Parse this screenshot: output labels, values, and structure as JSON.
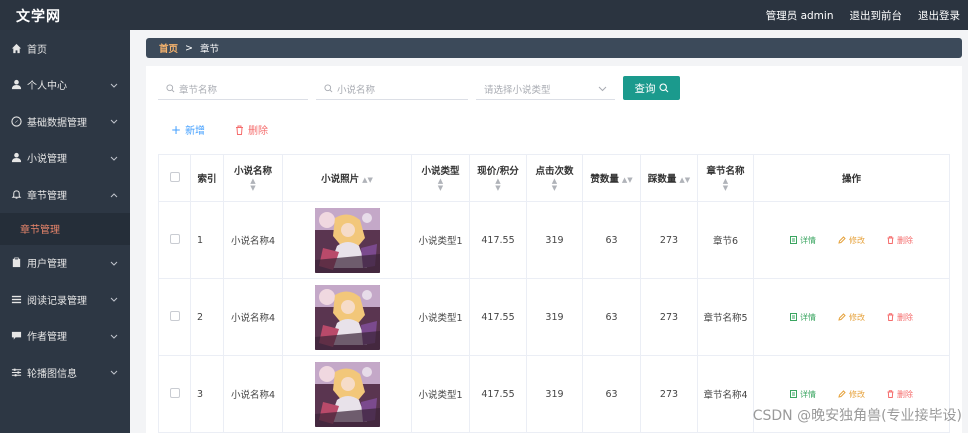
{
  "app": {
    "brand": "文学网",
    "admin_label": "管理员 admin",
    "exit_front": "退出到前台",
    "logout": "退出登录"
  },
  "sidebar": {
    "items": [
      {
        "label": "首页",
        "icon": "home-icon"
      },
      {
        "label": "个人中心",
        "icon": "user-icon"
      },
      {
        "label": "基础数据管理",
        "icon": "compass-icon"
      },
      {
        "label": "小说管理",
        "icon": "user-icon"
      },
      {
        "label": "章节管理",
        "icon": "bell-icon"
      },
      {
        "label": "章节管理",
        "icon": ""
      },
      {
        "label": "用户管理",
        "icon": "clipboard-icon"
      },
      {
        "label": "阅读记录管理",
        "icon": "list-icon"
      },
      {
        "label": "作者管理",
        "icon": "chat-icon"
      },
      {
        "label": "轮播图信息",
        "icon": "sliders-icon"
      }
    ]
  },
  "breadcrumb": {
    "home": "首页",
    "separator": ">",
    "current": "章节"
  },
  "filters": {
    "chapter_placeholder": "章节名称",
    "novel_placeholder": "小说名称",
    "type_placeholder": "请选择小说类型",
    "query_label": "查询"
  },
  "actions": {
    "add_label": "新增",
    "delete_label": "删除"
  },
  "table": {
    "headers": {
      "index": "索引",
      "novel_name": "小说名称",
      "novel_photo": "小说照片",
      "novel_type": "小说类型",
      "price": "现价/积分",
      "clicks": "点击次数",
      "likes": "赞数量",
      "dislikes": "踩数量",
      "chapter_name": "章节名称",
      "operations": "操作"
    },
    "op_labels": {
      "view": "详情",
      "edit": "修改",
      "delete": "删除"
    },
    "rows": [
      {
        "index": "1",
        "novel_name": "小说名称4",
        "novel_type": "小说类型1",
        "price": "417.55",
        "clicks": "319",
        "likes": "63",
        "dislikes": "273",
        "chapter_name": "章节6"
      },
      {
        "index": "2",
        "novel_name": "小说名称4",
        "novel_type": "小说类型1",
        "price": "417.55",
        "clicks": "319",
        "likes": "63",
        "dislikes": "273",
        "chapter_name": "章节名称5"
      },
      {
        "index": "3",
        "novel_name": "小说名称4",
        "novel_type": "小说类型1",
        "price": "417.55",
        "clicks": "319",
        "likes": "63",
        "dislikes": "273",
        "chapter_name": "章节名称4"
      }
    ]
  },
  "watermark": "CSDN @晚安独角兽(专业接毕设)",
  "colors": {
    "topbar": "#2b3440",
    "sidebar": "#2d3744",
    "accent_teal": "#1b9a8d",
    "active_submenu": "#e8856b",
    "add_blue": "#409eff",
    "delete_red": "#f56c6c"
  }
}
